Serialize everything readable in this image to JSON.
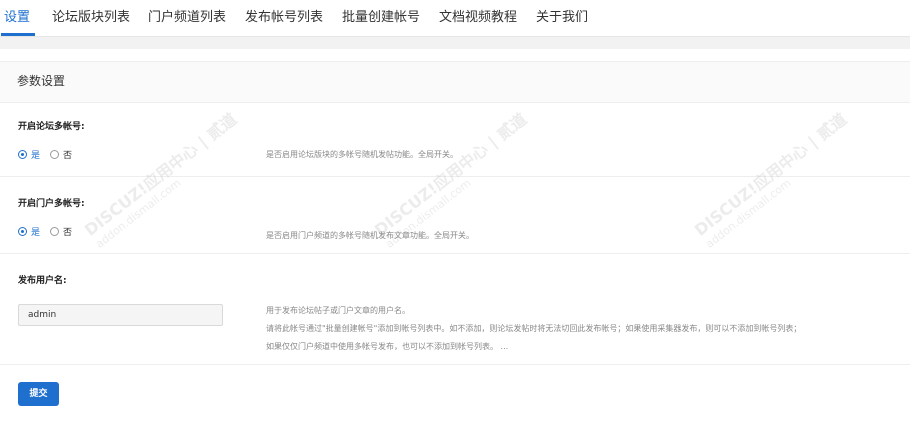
{
  "tabs": [
    "设置",
    "论坛版块列表",
    "门户频道列表",
    "发布帐号列表",
    "批量创建帐号",
    "文档视频教程",
    "关于我们"
  ],
  "panel": {
    "title": "参数设置"
  },
  "fields": {
    "forum_multi": {
      "label": "开启论坛多帐号:",
      "options": [
        "是",
        "否"
      ],
      "selected": "是",
      "description": "是否启用论坛版块的多帐号随机发帖功能。全局开关。"
    },
    "portal_multi": {
      "label": "开启门户多帐号:",
      "options": [
        "是",
        "否"
      ],
      "selected": "是",
      "description": "是否启用门户频道的多帐号随机发布文章功能。全局开关。"
    },
    "publish_user": {
      "label": "发布用户名:",
      "value": "admin",
      "description": [
        "用于发布论坛帖子或门户文章的用户名。",
        "请将此帐号通过\"批量创建帐号\"添加到帐号列表中。如不添加，则论坛发帖时将无法切回此发布帐号；如果使用采集器发布，则可以不添加到帐号列表；",
        "如果仅仅门户频道中使用多帐号发布，也可以不添加到帐号列表。 ..."
      ]
    }
  },
  "submit_label": "提交",
  "watermark": {
    "line1": "DISCUZ!应用中心 | 贰道",
    "line2": "addon.dismall.com"
  },
  "colors": {
    "accent": "#1e6fce"
  }
}
